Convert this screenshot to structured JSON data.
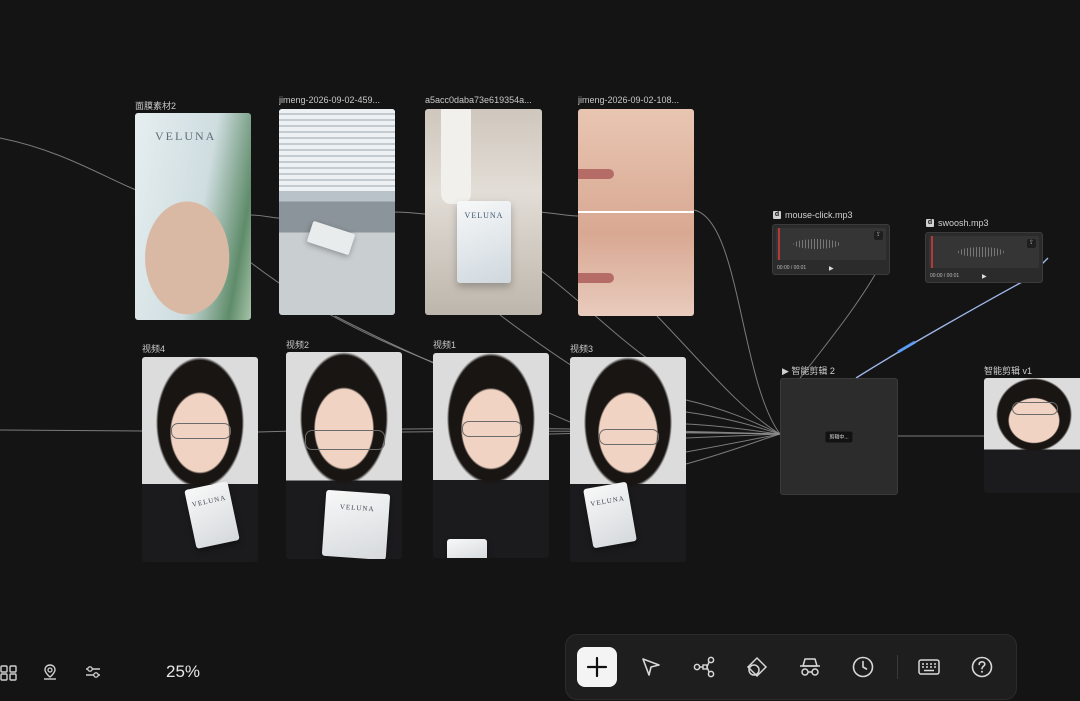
{
  "canvas": {
    "image_nodes": [
      {
        "id": "n1",
        "label": "面膜素材2"
      },
      {
        "id": "n2",
        "label": "jimeng-2026-09-02-459..."
      },
      {
        "id": "n3",
        "label": "a5acc0daba73e619354a..."
      },
      {
        "id": "n4",
        "label": "jimeng-2026-09-02-108..."
      }
    ],
    "video_nodes": [
      {
        "id": "v4",
        "label": "视频4"
      },
      {
        "id": "v2",
        "label": "视频2"
      },
      {
        "id": "v1",
        "label": "视频1"
      },
      {
        "id": "v3",
        "label": "视频3"
      }
    ],
    "brand_text": "VELUNA",
    "audio_nodes": [
      {
        "title": "mouse-click.mp3",
        "time": "00:00 / 00:01",
        "icon": "audio-file-icon"
      },
      {
        "title": "swoosh.mp3",
        "time": "00:00 / 00:01",
        "icon": "audio-file-icon"
      }
    ],
    "smart_cut": {
      "title": "▶ 智能剪辑 2",
      "status": "剪辑中..."
    },
    "output_node": {
      "title": "智能剪辑 v1"
    }
  },
  "bottom_left": {
    "icons": [
      "grid-icon",
      "location-pin-icon",
      "sliders-icon"
    ],
    "zoom": "25%"
  },
  "toolbar": {
    "tools": [
      {
        "name": "add",
        "icon": "plus-icon"
      },
      {
        "name": "select",
        "icon": "pointer-icon"
      },
      {
        "name": "workflow",
        "icon": "nodes-icon"
      },
      {
        "name": "shapes",
        "icon": "shapes-icon"
      },
      {
        "name": "incognito",
        "icon": "spy-icon"
      },
      {
        "name": "history",
        "icon": "clock-icon"
      },
      {
        "name": "keyboard",
        "icon": "keyboard-icon"
      },
      {
        "name": "help",
        "icon": "help-icon"
      }
    ]
  },
  "colors": {
    "background": "#141414",
    "active_wire": "#5aa0ff",
    "toolbar_bg": "#1e1e1e"
  }
}
